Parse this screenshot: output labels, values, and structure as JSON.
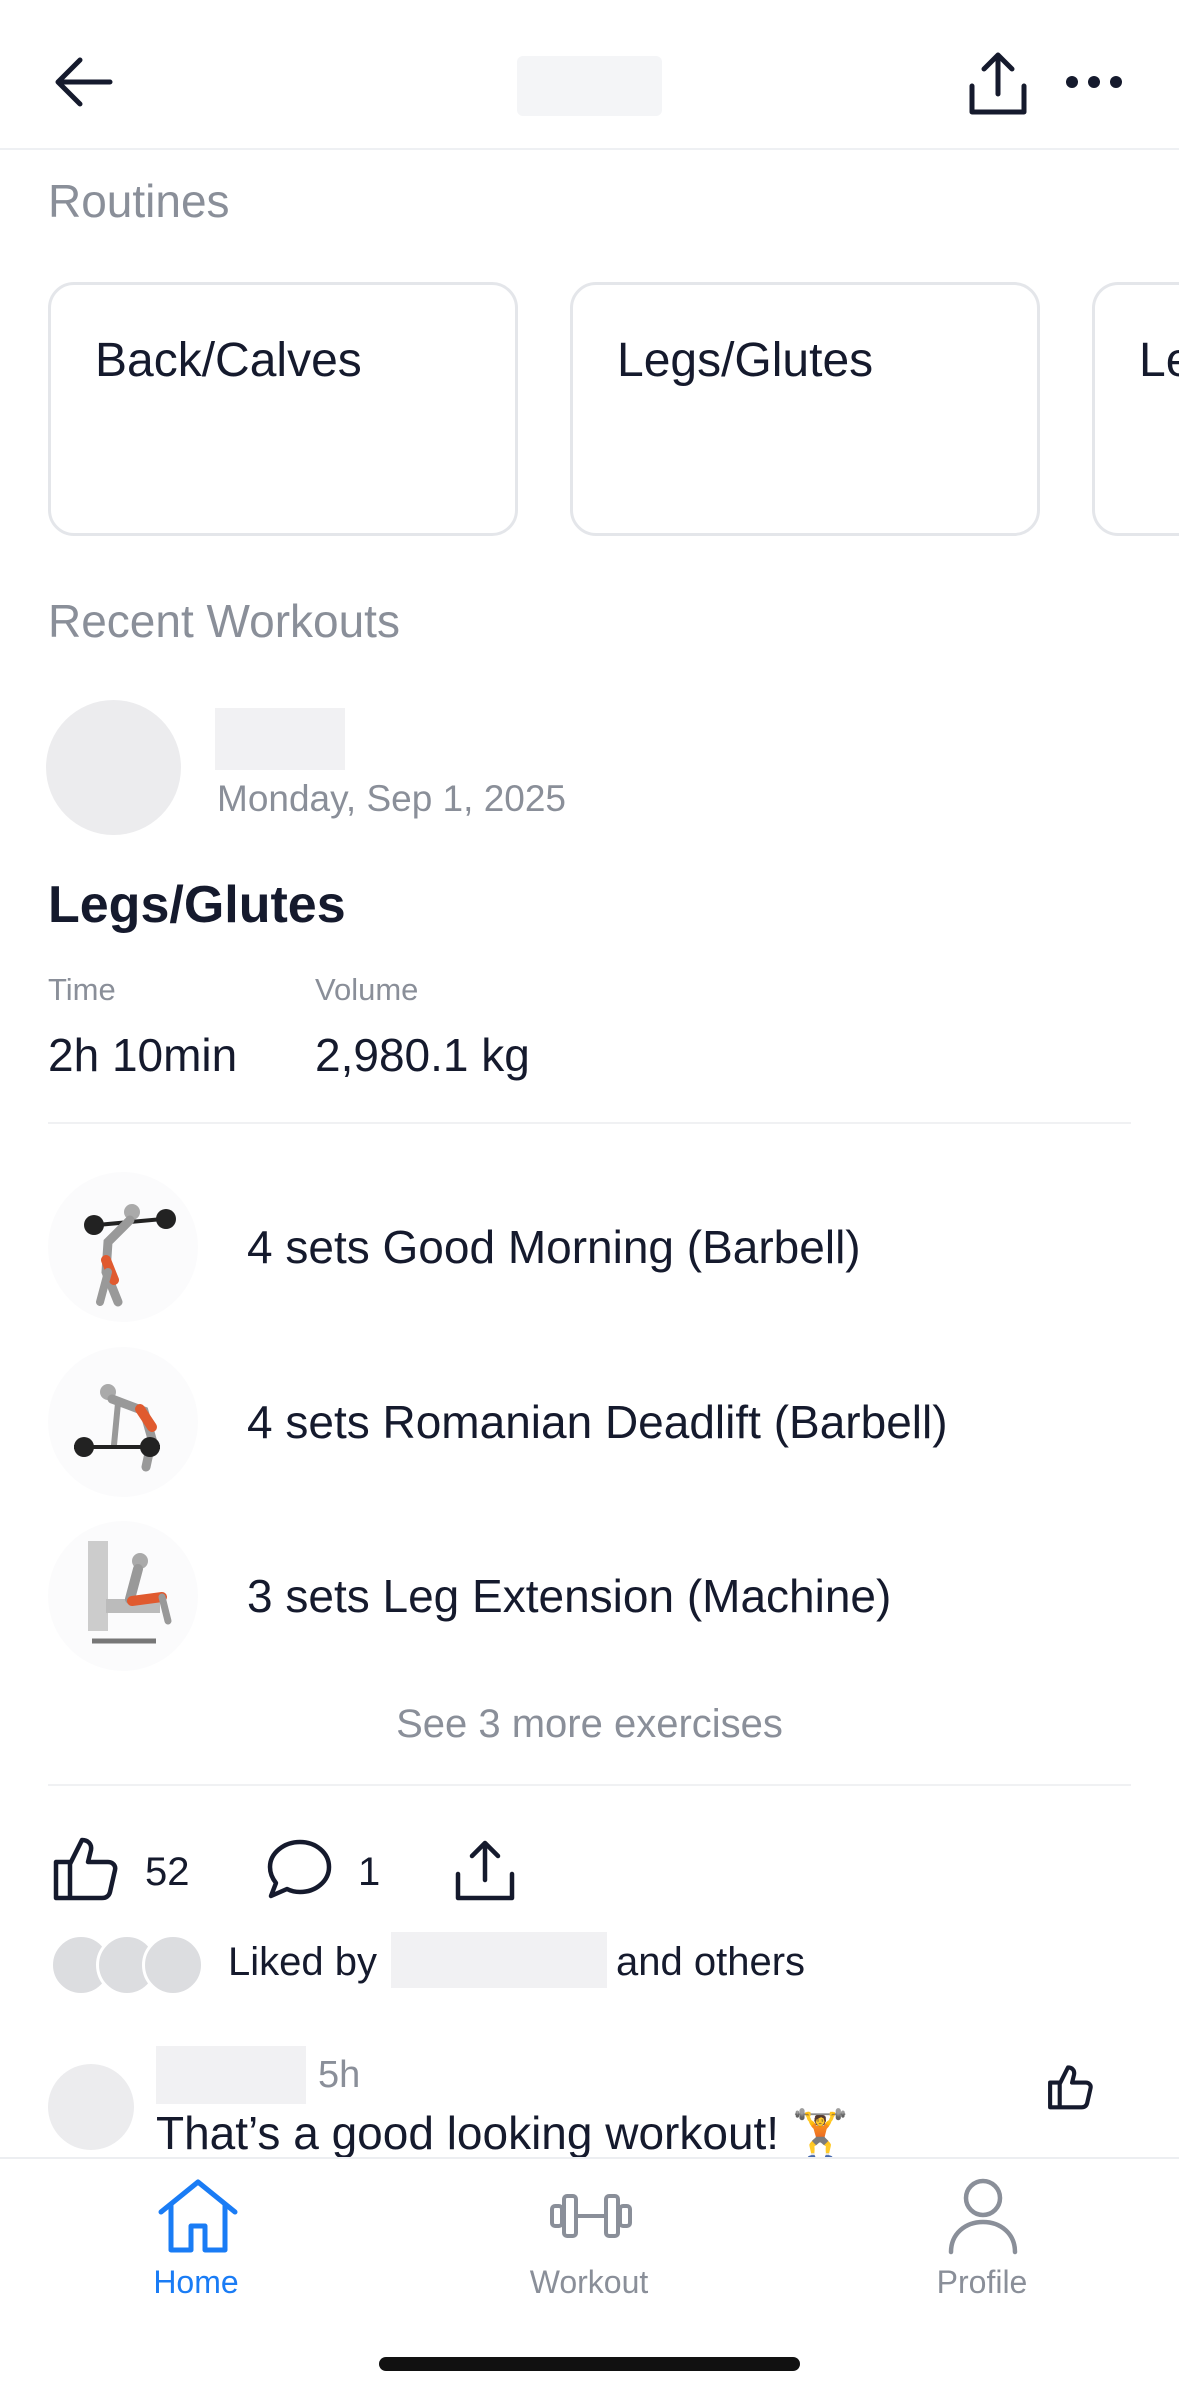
{
  "sections": {
    "routines_title": "Routines",
    "recent_title": "Recent Workouts"
  },
  "routines": [
    {
      "name": "Back/Calves"
    },
    {
      "name": "Legs/Glutes"
    },
    {
      "name": "Le"
    }
  ],
  "workout": {
    "date": "Monday, Sep 1, 2025",
    "title": "Legs/Glutes",
    "stats": {
      "time_label": "Time",
      "time_value": "2h 10min",
      "volume_label": "Volume",
      "volume_value": "2,980.1 kg"
    },
    "exercises": [
      {
        "text": "4 sets Good Morning (Barbell)"
      },
      {
        "text": "4 sets Romanian Deadlift (Barbell)"
      },
      {
        "text": "3 sets Leg Extension (Machine)"
      }
    ],
    "see_more": "See 3 more exercises",
    "likes_count": "52",
    "comments_count": "1",
    "liked_by_prefix": "Liked by",
    "liked_by_suffix": "and others"
  },
  "comment": {
    "time": "5h",
    "text": "That’s a good looking workout! 🏋️"
  },
  "tabbar": {
    "home": "Home",
    "workout": "Workout",
    "profile": "Profile"
  },
  "colors": {
    "accent": "#1a7cf5",
    "muted": "#8a8f99",
    "text": "#151a2d"
  }
}
